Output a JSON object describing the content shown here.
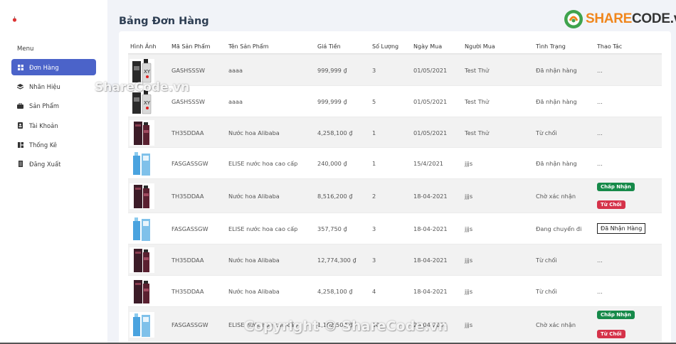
{
  "sidebar": {
    "menu_label": "Menu",
    "items": [
      {
        "label": "Đơn Hàng",
        "icon": "grid-icon",
        "active": true
      },
      {
        "label": "Nhãn Hiệu",
        "icon": "layers-icon",
        "active": false
      },
      {
        "label": "Sản Phẩm",
        "icon": "briefcase-icon",
        "active": false
      },
      {
        "label": "Tài Khoản",
        "icon": "user-card-icon",
        "active": false
      },
      {
        "label": "Thống Kê",
        "icon": "stats-icon",
        "active": false
      },
      {
        "label": "Đăng Xuất",
        "icon": "logout-icon",
        "active": false
      }
    ]
  },
  "page_title": "Bảng Đơn Hàng",
  "brand": {
    "prefix": "SHARE",
    "suffix": "CODE.vn"
  },
  "watermarks": {
    "top": "ShareCode.vn",
    "bottom": "Copyright © ShareCode.vn"
  },
  "columns": {
    "image": "Hình Ảnh",
    "code": "Mã Sản Phẩm",
    "name": "Tên Sản Phẩm",
    "price": "Giá Tiền",
    "qty": "Số Lượng",
    "date": "Ngày Mua",
    "buyer": "Người Mua",
    "status": "Tình Trạng",
    "action": "Thao Tác"
  },
  "rows": [
    {
      "img": "xy-bottle",
      "code": "GASHSSSW",
      "name": "aaaa",
      "price": "999,999 ₫",
      "qty": "3",
      "date": "01/05/2021",
      "buyer": "Test Thử",
      "status": "Đã nhận hàng",
      "action": "..."
    },
    {
      "img": "xy-bottle",
      "code": "GASHSSSW",
      "name": "aaaa",
      "price": "999,999 ₫",
      "qty": "5",
      "date": "01/05/2021",
      "buyer": "Test Thử",
      "status": "Đã nhận hàng",
      "action": "..."
    },
    {
      "img": "red-bottle",
      "code": "TH35DDAA",
      "name": "Nước hoa Alibaba",
      "price": "4,258,100 ₫",
      "qty": "1",
      "date": "01/05/2021",
      "buyer": "Test Thử",
      "status": "Từ chối",
      "action": "..."
    },
    {
      "img": "blue-bottle",
      "code": "FASGASSGW",
      "name": "ELISE nước hoa cao cấp",
      "price": "240,000 ₫",
      "qty": "1",
      "date": "15/4/2021",
      "buyer": "jjjs",
      "status": "Đã nhận hàng",
      "action": "..."
    },
    {
      "img": "red-bottle",
      "code": "TH35DDAA",
      "name": "Nước hoa Alibaba",
      "price": "8,516,200 ₫",
      "qty": "2",
      "date": "18-04-2021",
      "buyer": "jjjs",
      "status": "Chờ xác nhận",
      "accept": "Chấp Nhận",
      "reject": "Từ Chối"
    },
    {
      "img": "blue-bottle",
      "code": "FASGASSGW",
      "name": "ELISE nước hoa cao cấp",
      "price": "357,750 ₫",
      "qty": "3",
      "date": "18-04-2021",
      "buyer": "jjjs",
      "status": "Đang chuyển đi",
      "received": "Đã Nhận Hàng"
    },
    {
      "img": "red-bottle",
      "code": "TH35DDAA",
      "name": "Nước hoa Alibaba",
      "price": "12,774,300 ₫",
      "qty": "3",
      "date": "18-04-2021",
      "buyer": "jjjs",
      "status": "Từ chối",
      "action": "..."
    },
    {
      "img": "red-bottle",
      "code": "TH35DDAA",
      "name": "Nước hoa Alibaba",
      "price": "4,258,100 ₫",
      "qty": "4",
      "date": "18-04-2021",
      "buyer": "jjjs",
      "status": "Từ chối",
      "action": "..."
    },
    {
      "img": "blue-bottle",
      "code": "FASGASSGW",
      "name": "ELISE nước hoa cao cấp",
      "price": "1,192,500 ₫",
      "qty": "10",
      "date": "20-04-2021",
      "buyer": "jjjs",
      "status": "Chờ xác nhận",
      "accept": "Chấp Nhận",
      "reject": "Từ Chối"
    }
  ]
}
